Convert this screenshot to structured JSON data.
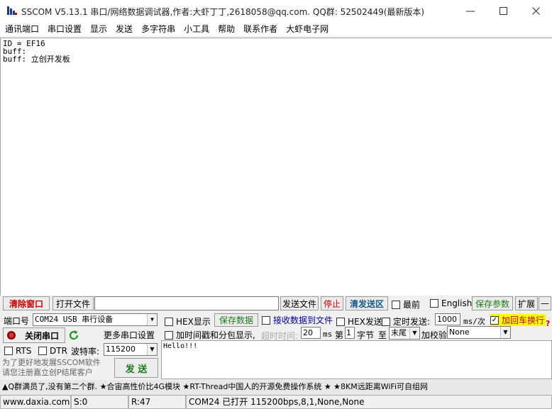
{
  "window": {
    "title": "SSCOM V5.13.1 串口/网络数据调试器,作者:大虾丁丁,2618058@qq.com. QQ群: 52502449(最新版本)"
  },
  "menu": [
    "通讯端口",
    "串口设置",
    "显示",
    "发送",
    "多字符串",
    "小工具",
    "帮助",
    "联系作者",
    "大虾电子网"
  ],
  "receive": {
    "lines": [
      "ID = EF16",
      "buff:",
      "buff: 立创开发板"
    ]
  },
  "toolbar": {
    "clear_window": "清除窗口",
    "open_file": "打开文件",
    "file_path": "",
    "send_file": "发送文件",
    "stop": "停止",
    "clear_send": "清发送区",
    "topmost": "最前",
    "english": "English",
    "save_params": "保存参数",
    "expand": "扩展",
    "collapse": "—"
  },
  "port": {
    "label": "端口号",
    "value": "COM24 USB 串行设备",
    "close_port": "关闭串口",
    "more_settings": "更多串口设置",
    "rts": "RTS",
    "dtr": "DTR",
    "baud_label": "波特率:",
    "baud_value": "115200"
  },
  "options": {
    "hex_display": "HEX显示",
    "save_data": "保存数据",
    "recv_to_file": "接收数据到文件",
    "hex_send": "HEX发送",
    "timed_send": "定时发送:",
    "interval": "1000",
    "interval_unit": "ms/次",
    "add_crlf": "加回车换行",
    "add_crlf_checked": "✓",
    "timestamp": "加时间戳和分包显示,",
    "timeout_label": "超时时间:",
    "timeout_value": "20",
    "timeout_unit": "ms",
    "byte_from_label": "第",
    "byte_from_value": "1",
    "byte_label": "字节",
    "to_label": "至",
    "to_value": "末尾",
    "checksum_label": "加校验",
    "checksum_value": "None",
    "help": "?"
  },
  "send": {
    "text": "Hello!!!",
    "button": "发 送",
    "promo": "为了更好地发展SSCOM软件\n请您注册嘉立创P结尾客户"
  },
  "ad": "▲Q群满员了,没有第二个群. ★合宙高性价比4G模块 ★RT-Thread中国人的开源免费操作系统 ★ ★8KM远距离WiFi可自组网",
  "status": {
    "website": "www.daxia.com",
    "sent": "S:0",
    "received": "R:47",
    "port_state": "COM24 已打开  115200bps,8,1,None,None"
  },
  "colors": {
    "accent_red": "#c00000",
    "accent_green": "#1a7d1a",
    "crlf_highlight": "#ffff00"
  }
}
